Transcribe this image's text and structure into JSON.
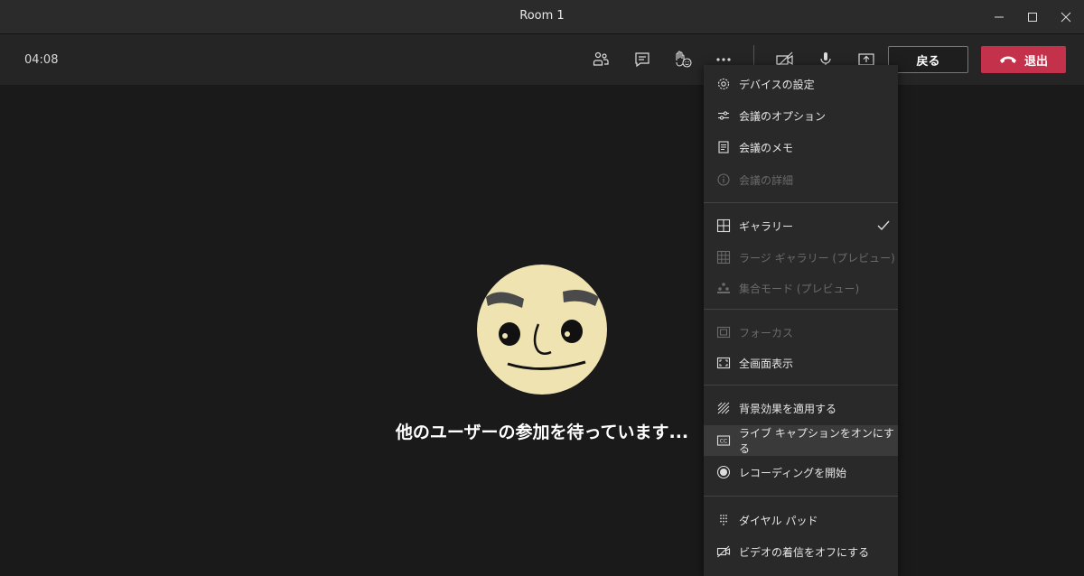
{
  "window": {
    "title": "Room 1"
  },
  "toolbar": {
    "timer": "04:08",
    "back_label": "戻る",
    "leave_label": "退出"
  },
  "stage": {
    "waiting_text": "他のユーザーの参加を待っています..."
  },
  "menu": {
    "items": [
      {
        "label": "デバイスの設定",
        "icon": "gear-icon",
        "enabled": true
      },
      {
        "label": "会議のオプション",
        "icon": "sliders-icon",
        "enabled": true
      },
      {
        "label": "会議のメモ",
        "icon": "notes-icon",
        "enabled": true
      },
      {
        "label": "会議の詳細",
        "icon": "info-icon",
        "enabled": false
      },
      {
        "label": "ギャラリー",
        "icon": "gallery-grid-icon",
        "enabled": true,
        "checked": true
      },
      {
        "label": "ラージ ギャラリー (プレビュー)",
        "icon": "large-gallery-icon",
        "enabled": false
      },
      {
        "label": "集合モード (プレビュー)",
        "icon": "together-mode-icon",
        "enabled": false
      },
      {
        "label": "フォーカス",
        "icon": "focus-icon",
        "enabled": false
      },
      {
        "label": "全画面表示",
        "icon": "fullscreen-icon",
        "enabled": true
      },
      {
        "label": "背景効果を適用する",
        "icon": "background-effects-icon",
        "enabled": true
      },
      {
        "label": "ライブ キャプションをオンにする",
        "icon": "cc-icon",
        "enabled": true,
        "highlighted": true
      },
      {
        "label": "レコーディングを開始",
        "icon": "record-icon",
        "enabled": true
      },
      {
        "label": "ダイヤル パッド",
        "icon": "dialpad-icon",
        "enabled": true
      },
      {
        "label": "ビデオの着信をオフにする",
        "icon": "video-off-icon",
        "enabled": true
      }
    ]
  },
  "colors": {
    "leave_button": "#c4314b",
    "menu_bg": "#292929",
    "stage_bg": "#1a1a1a"
  }
}
